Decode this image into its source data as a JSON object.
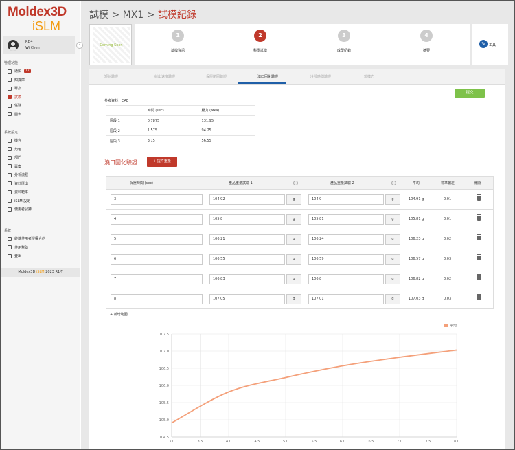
{
  "brand": {
    "main": "Moldex3D",
    "sub": "iSLM"
  },
  "user": {
    "id": "RD4",
    "name": "Wi Chen"
  },
  "sidebar": {
    "section1": "管理功能",
    "section2": "系統設定",
    "section3": "系統",
    "items1": [
      {
        "label": "通知",
        "badge": "17"
      },
      {
        "label": "知識庫"
      },
      {
        "label": "專案"
      },
      {
        "label": "試模"
      },
      {
        "label": "任務"
      },
      {
        "label": "圖表"
      }
    ],
    "items2": [
      {
        "label": "機台"
      },
      {
        "label": "角色"
      },
      {
        "label": "部門"
      },
      {
        "label": "專案"
      },
      {
        "label": "分析流程"
      },
      {
        "label": "資料匯出"
      },
      {
        "label": "資料範本"
      },
      {
        "label": "iSLM 設定"
      },
      {
        "label": "使用者記錄"
      }
    ],
    "items3": [
      {
        "label": "終端使用者授權合約"
      },
      {
        "label": "使用幫助"
      },
      {
        "label": "登出"
      }
    ],
    "version_prefix": "Moldex3D ",
    "version_accent": "iSLM",
    "version_suffix": " 2023 R1-T"
  },
  "breadcrumb": {
    "a": "試模",
    "sep": ">",
    "b": "MX1",
    "c": "試模紀錄"
  },
  "mold_placeholder": "Coming Soon",
  "steps": [
    {
      "num": "1",
      "label": "試模資訊"
    },
    {
      "num": "2",
      "label": "科學試模"
    },
    {
      "num": "3",
      "label": "成型紀錄"
    },
    {
      "num": "4",
      "label": "摘要"
    }
  ],
  "tool_label": "工具",
  "tabs": [
    "短射驗證",
    "射出速度驗證",
    "保壓範圍驗證",
    "澆口固化驗證",
    "冷卻時間驗證",
    "鎖模力"
  ],
  "submit_label": "提交",
  "reference": {
    "label": "參考資料：CAE",
    "headers": [
      "",
      "時間 (sec)",
      "壓力 (MPa)"
    ],
    "rows": [
      [
        "區段 1",
        "0.7875",
        "131.95"
      ],
      [
        "區段 2",
        "1.575",
        "94.25"
      ],
      [
        "區段 3",
        "3.15",
        "56.55"
      ]
    ]
  },
  "section_title": "澆口固化驗證",
  "add_button": "+ 提件重量",
  "grid": {
    "headers": [
      "保壓時間 (sec)",
      "產品重量試驗 1",
      "產品重量試驗 2",
      "平均",
      "標準偏差",
      "刪除"
    ],
    "unit": "g",
    "rows": [
      {
        "time": "3",
        "w1": "104.92",
        "w2": "104.9",
        "avg": "104.91 g",
        "std": "0.01"
      },
      {
        "time": "4",
        "w1": "105.8",
        "w2": "105.81",
        "avg": "105.81 g",
        "std": "0.01"
      },
      {
        "time": "5",
        "w1": "106.21",
        "w2": "106.24",
        "avg": "106.23 g",
        "std": "0.02"
      },
      {
        "time": "6",
        "w1": "106.55",
        "w2": "106.59",
        "avg": "106.57 g",
        "std": "0.03"
      },
      {
        "time": "7",
        "w1": "106.83",
        "w2": "106.8",
        "avg": "106.82 g",
        "std": "0.02"
      },
      {
        "time": "8",
        "w1": "107.05",
        "w2": "107.01",
        "avg": "107.03 g",
        "std": "0.03"
      }
    ],
    "add_row": "+ 新增範圍"
  },
  "colors": {
    "accent": "#c0392b",
    "submit": "#7ec24a",
    "series": "#f4a07a"
  },
  "chart_data": {
    "type": "line",
    "legend": "平均",
    "x": [
      3,
      4,
      5,
      6,
      7,
      8
    ],
    "series": [
      {
        "name": "平均",
        "values": [
          104.91,
          105.81,
          106.23,
          106.57,
          106.82,
          107.03
        ]
      }
    ],
    "xlim": [
      3.0,
      8.0
    ],
    "ylim": [
      104.5,
      107.5
    ],
    "xticks": [
      "3.0",
      "3.5",
      "4.0",
      "4.5",
      "5.0",
      "5.5",
      "6.0",
      "6.5",
      "7.0",
      "7.5",
      "8.0"
    ],
    "yticks": [
      "104.5",
      "105.0",
      "105.5",
      "106.0",
      "106.5",
      "107.0",
      "107.5"
    ],
    "legend_position": "top-right",
    "grid": true
  }
}
